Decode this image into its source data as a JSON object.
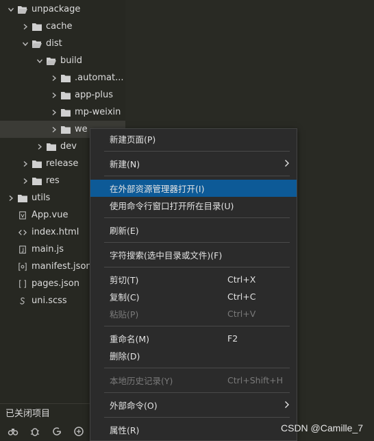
{
  "tree": [
    {
      "label": "unpackage",
      "chevron": "down",
      "icon": "folder-open"
    },
    {
      "label": "cache",
      "chevron": "right",
      "icon": "folder"
    },
    {
      "label": "dist",
      "chevron": "down",
      "icon": "folder-open"
    },
    {
      "label": "build",
      "chevron": "down",
      "icon": "folder-open"
    },
    {
      "label": ".automat...",
      "chevron": "right",
      "icon": "folder"
    },
    {
      "label": "app-plus",
      "chevron": "right",
      "icon": "folder"
    },
    {
      "label": "mp-weixin",
      "chevron": "right",
      "icon": "folder"
    },
    {
      "label": "we",
      "chevron": "right",
      "icon": "folder"
    },
    {
      "label": "dev",
      "chevron": "right",
      "icon": "folder"
    },
    {
      "label": "release",
      "chevron": "right",
      "icon": "folder"
    },
    {
      "label": "res",
      "chevron": "right",
      "icon": "folder"
    },
    {
      "label": "utils",
      "chevron": "right",
      "icon": "folder"
    },
    {
      "label": "App.vue",
      "chevron": "none",
      "icon": "vue-file"
    },
    {
      "label": "index.html",
      "chevron": "none",
      "icon": "html-file"
    },
    {
      "label": "main.js",
      "chevron": "none",
      "icon": "js-file"
    },
    {
      "label": "manifest.json",
      "chevron": "none",
      "icon": "manifest-file"
    },
    {
      "label": "pages.json",
      "chevron": "none",
      "icon": "json-file"
    },
    {
      "label": "uni.scss",
      "chevron": "none",
      "icon": "scss-file"
    }
  ],
  "bottom": {
    "closed_projects_label": "已关闭项目",
    "icons": [
      "binoculars-icon",
      "bug-icon",
      "refresh-g-icon",
      "plugin-icon"
    ]
  },
  "context_menu": {
    "items": [
      {
        "label": "新建页面(P)",
        "shortcut": "",
        "submenu": false,
        "disabled": false,
        "highlighted": false
      },
      {
        "label": "新建(N)",
        "shortcut": "",
        "submenu": true,
        "disabled": false,
        "highlighted": false
      },
      {
        "label": "在外部资源管理器打开(I)",
        "shortcut": "",
        "submenu": false,
        "disabled": false,
        "highlighted": true
      },
      {
        "label": "使用命令行窗口打开所在目录(U)",
        "shortcut": "",
        "submenu": false,
        "disabled": false,
        "highlighted": false
      },
      {
        "label": "刷新(E)",
        "shortcut": "",
        "submenu": false,
        "disabled": false,
        "highlighted": false
      },
      {
        "label": "字符搜索(选中目录或文件)(F)",
        "shortcut": "",
        "submenu": false,
        "disabled": false,
        "highlighted": false
      },
      {
        "label": "剪切(T)",
        "shortcut": "Ctrl+X",
        "submenu": false,
        "disabled": false,
        "highlighted": false
      },
      {
        "label": "复制(C)",
        "shortcut": "Ctrl+C",
        "submenu": false,
        "disabled": false,
        "highlighted": false
      },
      {
        "label": "粘贴(P)",
        "shortcut": "Ctrl+V",
        "submenu": false,
        "disabled": true,
        "highlighted": false
      },
      {
        "label": "重命名(M)",
        "shortcut": "F2",
        "submenu": false,
        "disabled": false,
        "highlighted": false
      },
      {
        "label": "删除(D)",
        "shortcut": "",
        "submenu": false,
        "disabled": false,
        "highlighted": false
      },
      {
        "label": "本地历史记录(Y)",
        "shortcut": "Ctrl+Shift+H",
        "submenu": false,
        "disabled": true,
        "highlighted": false
      },
      {
        "label": "外部命令(O)",
        "shortcut": "",
        "submenu": true,
        "disabled": false,
        "highlighted": false
      },
      {
        "label": "属性(R)",
        "shortcut": "",
        "submenu": false,
        "disabled": false,
        "highlighted": false
      }
    ]
  },
  "watermark": "CSDN @Camille_7",
  "colors": {
    "highlight": "#0d5a97",
    "background": "#272822",
    "menu_bg": "#2b2b2b"
  }
}
